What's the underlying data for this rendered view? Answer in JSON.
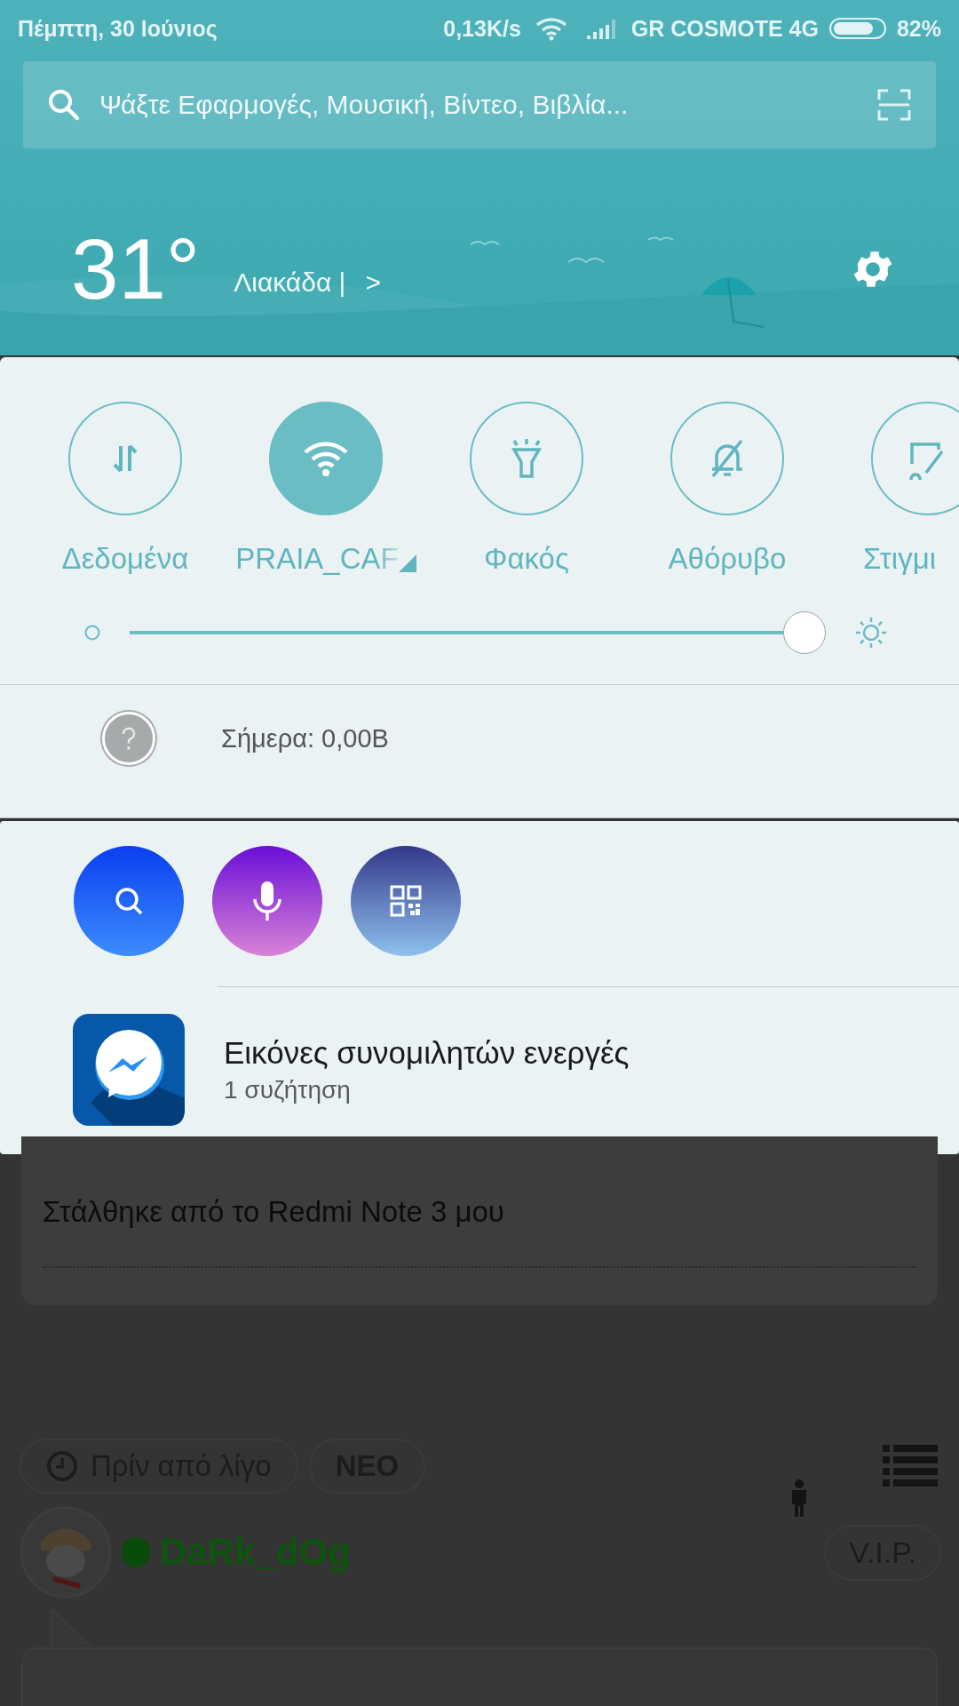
{
  "status_bar": {
    "date": "Πέμπτη, 30 Ιούνιος",
    "speed": "0,13K/s",
    "carrier": "GR COSMOTE 4G",
    "battery_gauge": {
      "level": 0.82
    },
    "battery": "82%"
  },
  "search": {
    "placeholder": "Ψάξτε Εφαρμογές, Μουσική, Βίντεο, Βιβλία..."
  },
  "weather": {
    "temperature": "31°",
    "condition": "Λιακάδα |",
    "more": ">"
  },
  "toggles": [
    {
      "label": "Δεδομένα",
      "on": false,
      "has_menu": false
    },
    {
      "label": "PRAIA_CAF",
      "on": true,
      "has_menu": true
    },
    {
      "label": "Φακός",
      "on": false,
      "has_menu": false
    },
    {
      "label": "Αθόρυβο",
      "on": false,
      "has_menu": false
    },
    {
      "label": "Στιγμι",
      "on": false,
      "has_menu": false
    }
  ],
  "brightness": {
    "level": 1.0
  },
  "data_usage": {
    "text": "Σήμερα: 0,00B"
  },
  "notification": {
    "title": "Εικόνες συνομιλητών ενεργές",
    "subtitle": "1 συζήτηση"
  },
  "background": {
    "signature": "Στάλθηκε από το Redmi Note 3 μου",
    "chips": [
      {
        "label": "Πρίν από λίγο",
        "kind": "time"
      },
      {
        "label": "ΝΕΟ",
        "kind": "tag"
      }
    ],
    "user": {
      "name": "DaRk_dOg",
      "online": true,
      "badge": "V.I.P."
    }
  }
}
